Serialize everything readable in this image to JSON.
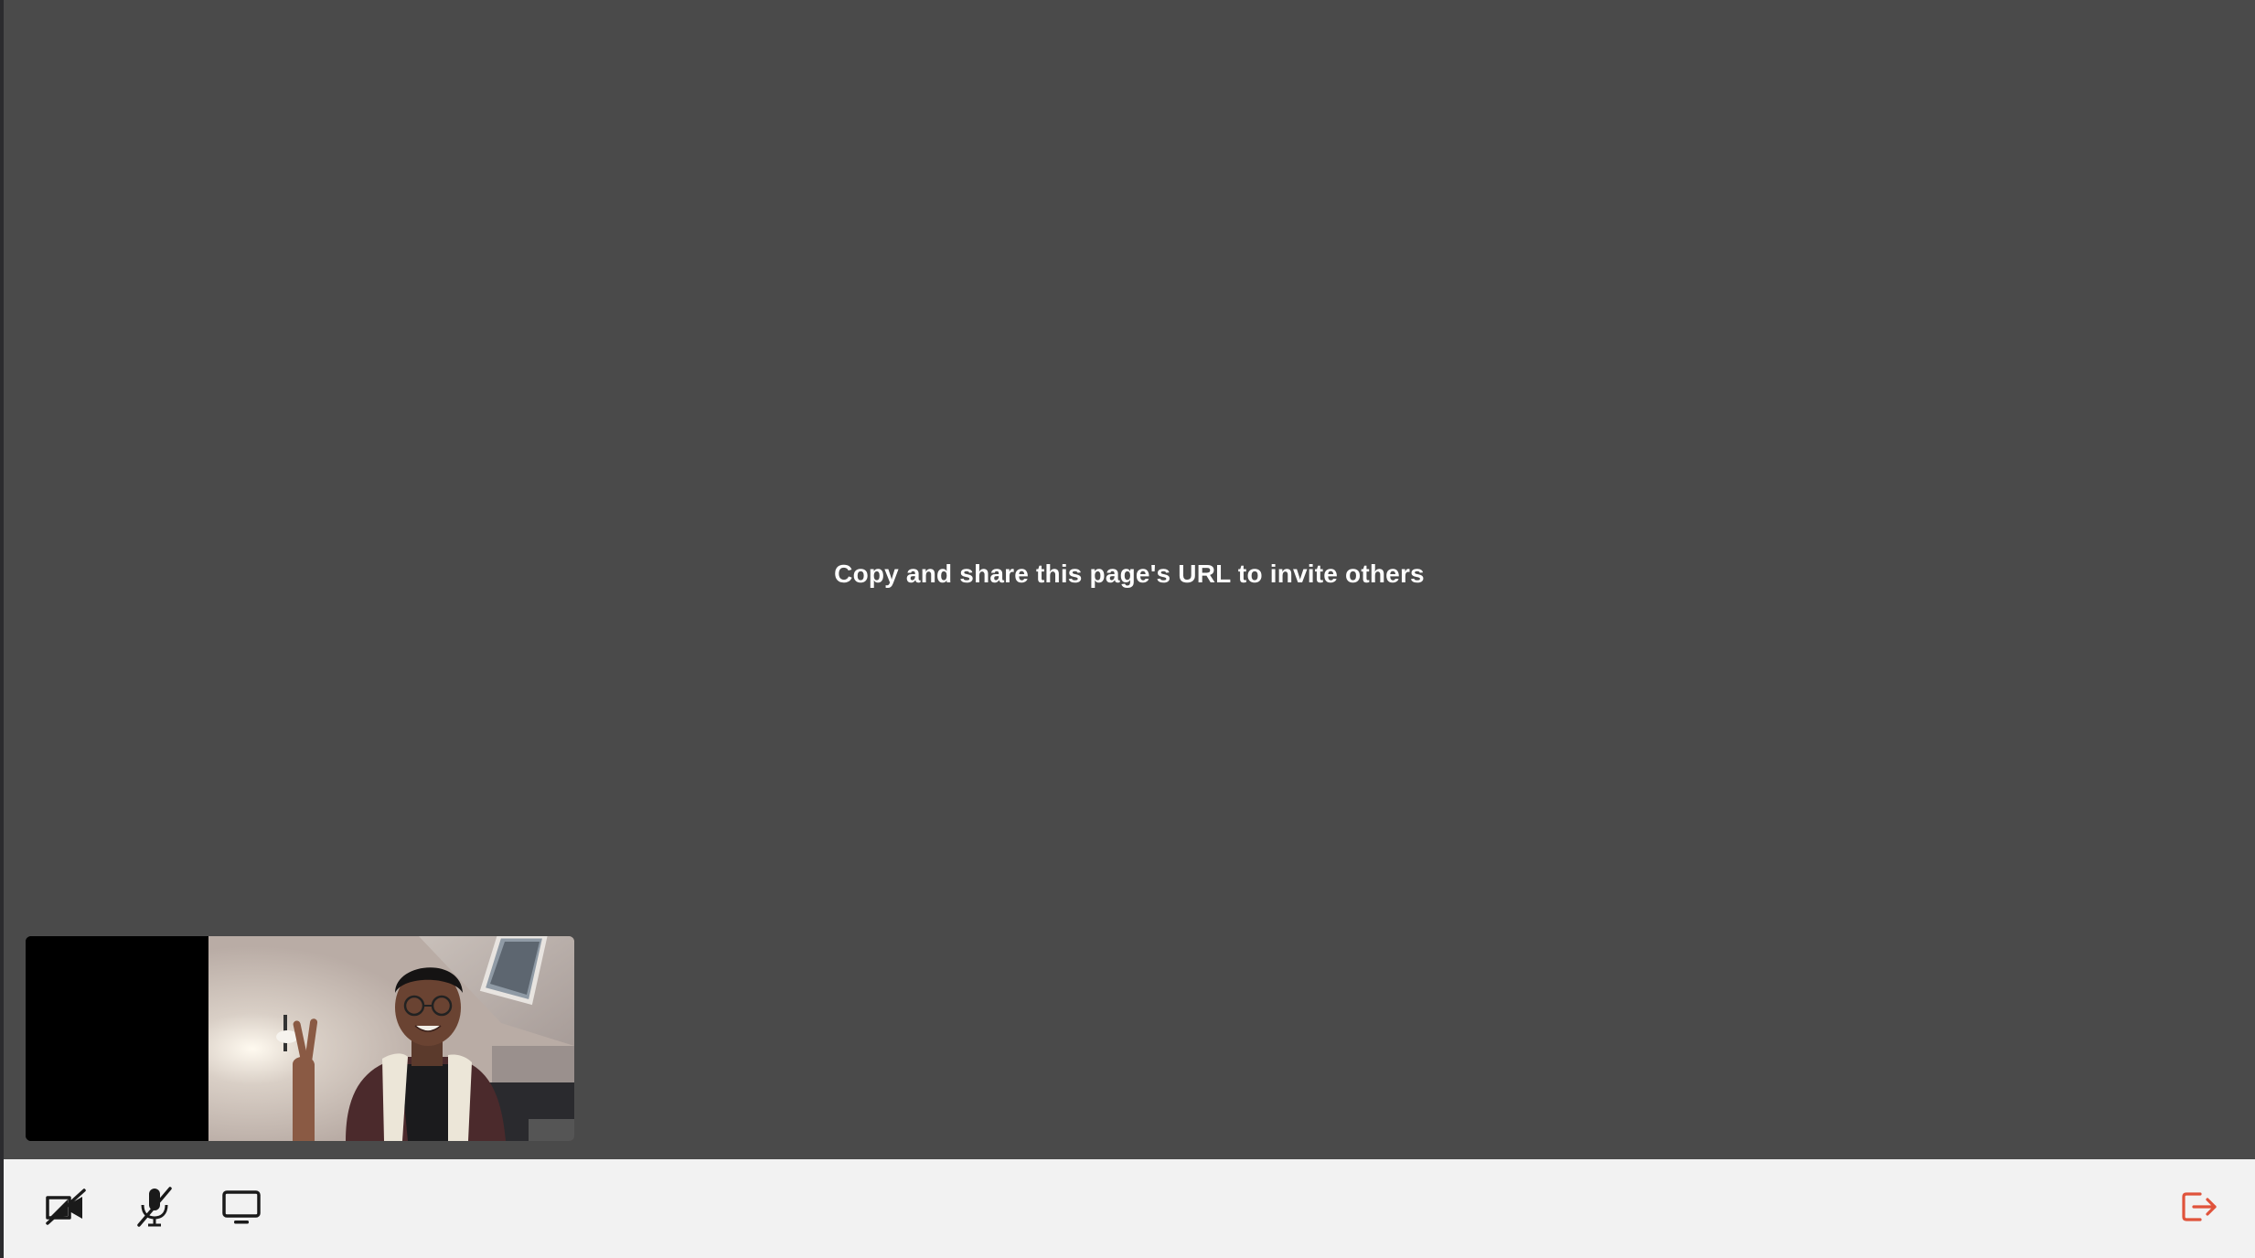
{
  "stage": {
    "invite_message": "Copy and share this page's URL to invite others"
  },
  "toolbar": {
    "camera": {
      "icon": "camera-off-icon",
      "state": "off"
    },
    "microphone": {
      "icon": "microphone-off-icon",
      "state": "muted"
    },
    "screen_share": {
      "icon": "monitor-icon"
    },
    "leave": {
      "icon": "leave-icon",
      "color": "#e0533b"
    }
  },
  "colors": {
    "stage_background": "#4a4a4a",
    "toolbar_background": "#f2f2f2",
    "icon_dark": "#1a1a1a",
    "leave_accent": "#e0533b"
  }
}
